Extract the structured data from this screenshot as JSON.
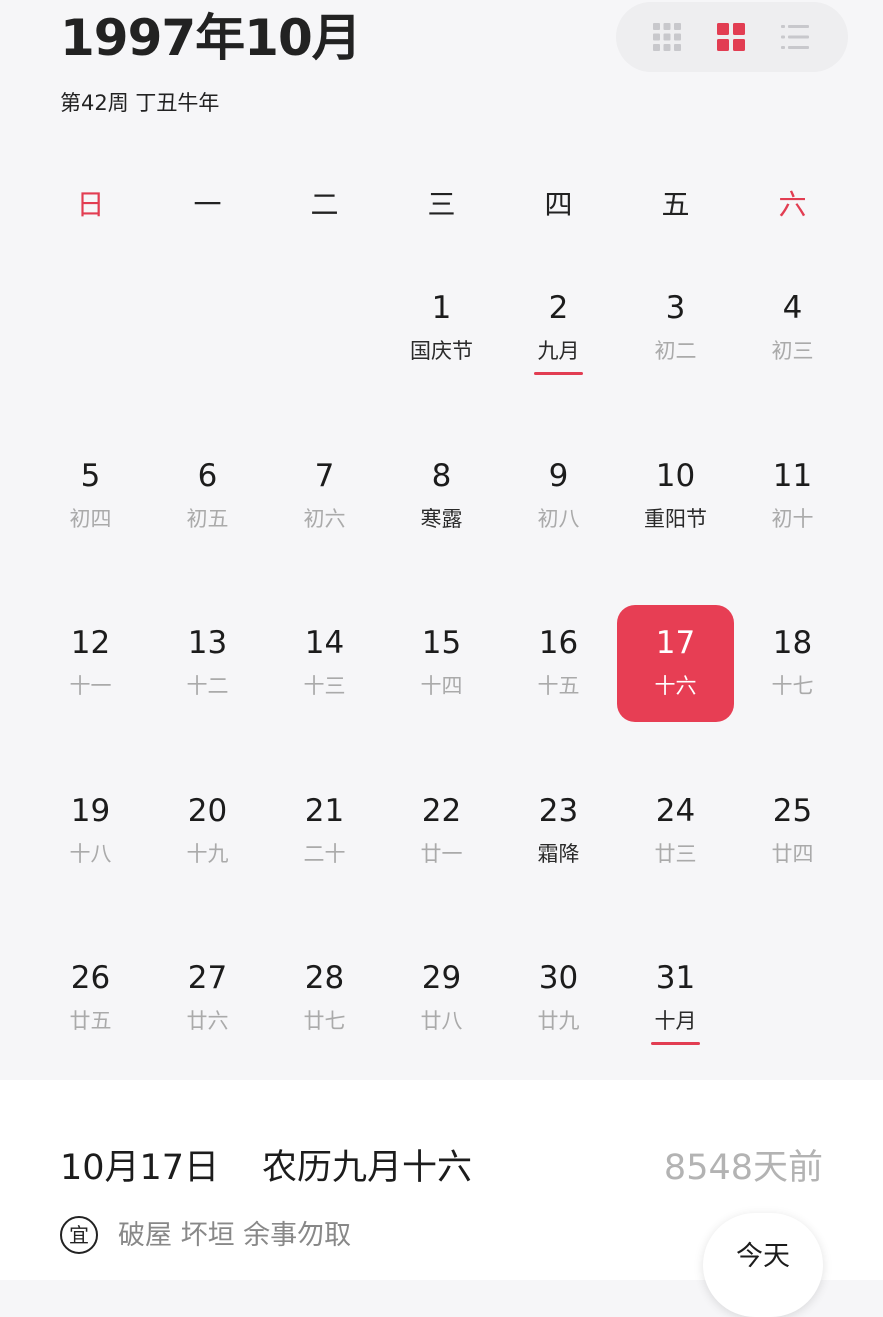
{
  "header": {
    "month_title": "1997年10月",
    "subtitle": "第42周 丁丑牛年"
  },
  "view_switch": {
    "options": [
      "grid9-icon",
      "grid4-icon",
      "list-icon"
    ],
    "active": "grid4-icon",
    "accent": "#e23d52",
    "inactive_color": "#c8c8cc"
  },
  "weekdays": [
    {
      "label": "日",
      "weekend": true
    },
    {
      "label": "一",
      "weekend": false
    },
    {
      "label": "二",
      "weekend": false
    },
    {
      "label": "三",
      "weekend": false
    },
    {
      "label": "四",
      "weekend": false
    },
    {
      "label": "五",
      "weekend": false
    },
    {
      "label": "六",
      "weekend": true
    }
  ],
  "calendar": {
    "first_weekday_index": 3,
    "selected_day": 17,
    "days": [
      {
        "day": "1",
        "lunar": "国庆节",
        "special": true
      },
      {
        "day": "2",
        "lunar": "九月",
        "special": true,
        "marked": true
      },
      {
        "day": "3",
        "lunar": "初二"
      },
      {
        "day": "4",
        "lunar": "初三"
      },
      {
        "day": "5",
        "lunar": "初四"
      },
      {
        "day": "6",
        "lunar": "初五"
      },
      {
        "day": "7",
        "lunar": "初六"
      },
      {
        "day": "8",
        "lunar": "寒露",
        "special": true
      },
      {
        "day": "9",
        "lunar": "初八"
      },
      {
        "day": "10",
        "lunar": "重阳节",
        "special": true
      },
      {
        "day": "11",
        "lunar": "初十"
      },
      {
        "day": "12",
        "lunar": "十一"
      },
      {
        "day": "13",
        "lunar": "十二"
      },
      {
        "day": "14",
        "lunar": "十三"
      },
      {
        "day": "15",
        "lunar": "十四"
      },
      {
        "day": "16",
        "lunar": "十五"
      },
      {
        "day": "17",
        "lunar": "十六"
      },
      {
        "day": "18",
        "lunar": "十七"
      },
      {
        "day": "19",
        "lunar": "十八"
      },
      {
        "day": "20",
        "lunar": "十九"
      },
      {
        "day": "21",
        "lunar": "二十"
      },
      {
        "day": "22",
        "lunar": "廿一"
      },
      {
        "day": "23",
        "lunar": "霜降",
        "special": true
      },
      {
        "day": "24",
        "lunar": "廿三"
      },
      {
        "day": "25",
        "lunar": "廿四"
      },
      {
        "day": "26",
        "lunar": "廿五"
      },
      {
        "day": "27",
        "lunar": "廿六"
      },
      {
        "day": "28",
        "lunar": "廿七"
      },
      {
        "day": "29",
        "lunar": "廿八"
      },
      {
        "day": "30",
        "lunar": "廿九"
      },
      {
        "day": "31",
        "lunar": "十月",
        "special": true,
        "marked": true
      }
    ]
  },
  "detail": {
    "date": "10月17日",
    "lunar_date": "农历九月十六",
    "days_ago": "8548天前",
    "yi_label": "宜",
    "yi_items": "破屋 坏垣 余事勿取",
    "today_button": "今天"
  }
}
